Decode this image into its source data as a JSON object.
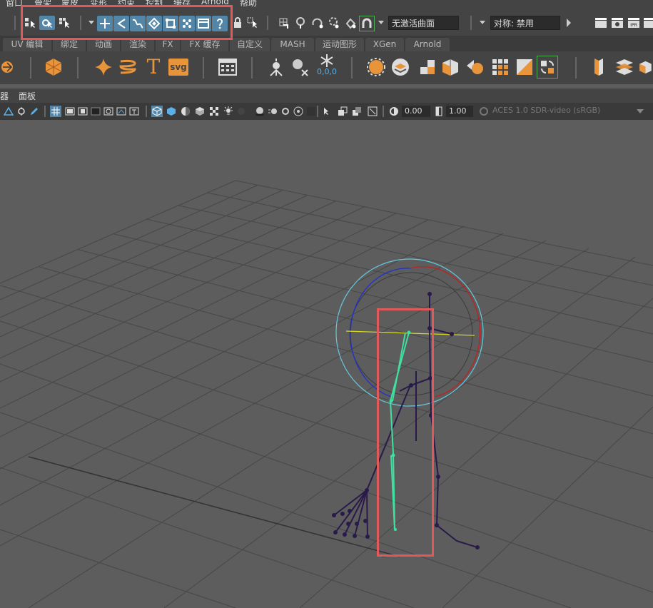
{
  "menubar": {
    "items": [
      "窗口",
      "骨架",
      "蒙皮",
      "变形",
      "约束",
      "控制",
      "缓存",
      "Arnold",
      "帮助"
    ]
  },
  "status_line": {
    "surface_field": "无激活曲面",
    "symmetry_field": "对称: 禁用"
  },
  "shelf_tabs": [
    "UV 编辑",
    "绑定",
    "动画",
    "渲染",
    "FX",
    "FX 缓存",
    "自定义",
    "MASH",
    "运动图形",
    "XGen",
    "Arnold"
  ],
  "shelf": {
    "svg_label": "svg",
    "type_label": "T",
    "coords_label": "0,0,0"
  },
  "panel_menu": {
    "items": [
      "器",
      "面板"
    ]
  },
  "panel_toolbar": {
    "exposure_value": "0.00",
    "gamma_value": "1.00",
    "color_space": "ACES 1.0 SDR-video (sRGB)"
  },
  "colors": {
    "highlight": "#e05a5a",
    "selected_button": "#5285a6",
    "selected_joint": "#40e0a0",
    "joint": "#2a1a4a",
    "grid": "#484848"
  }
}
